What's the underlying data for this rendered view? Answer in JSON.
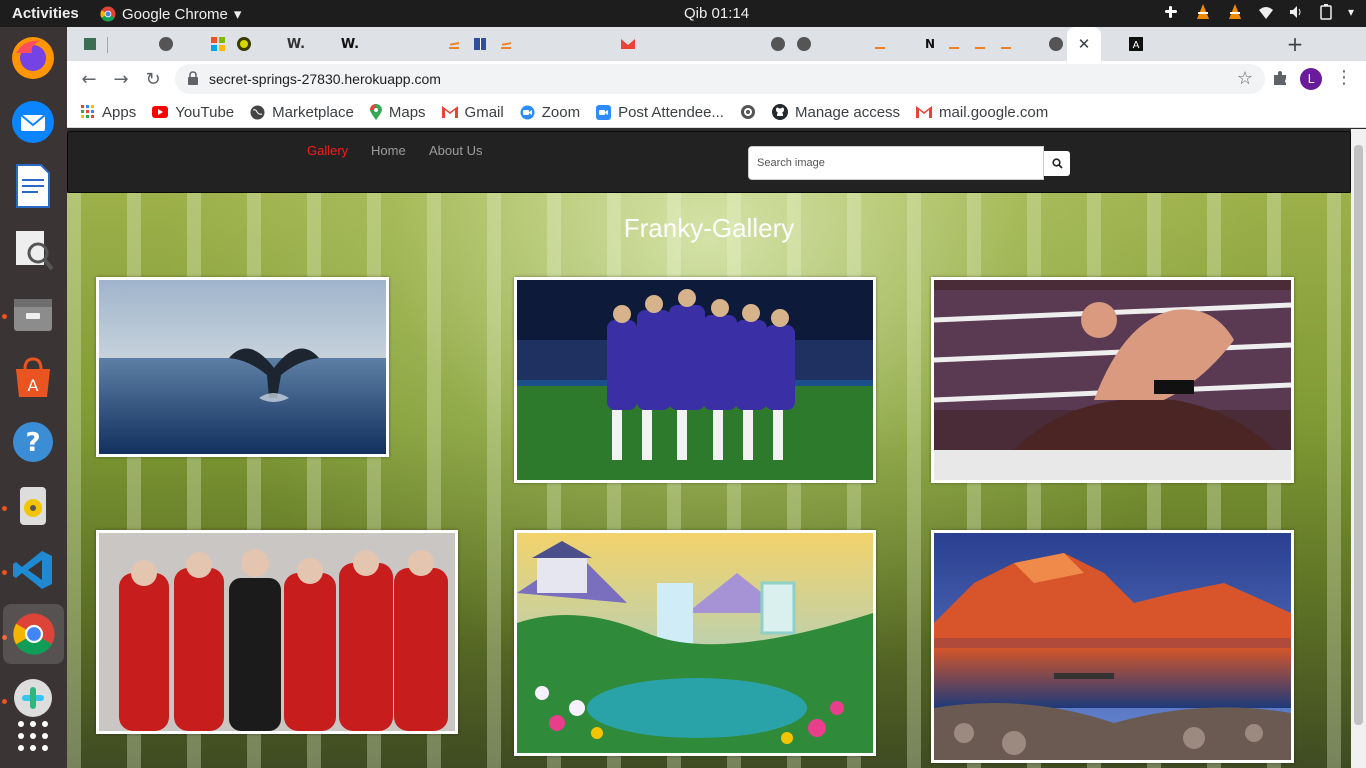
{
  "system": {
    "activities": "Activities",
    "app_name": "Google Chrome",
    "clock": "Qib 01:14"
  },
  "browser": {
    "url": "secret-springs-27830.herokuapp.com",
    "avatar_letter": "L",
    "bookmarks": [
      {
        "label": "Apps",
        "icon": "apps-grid-icon"
      },
      {
        "label": "YouTube",
        "icon": "youtube-icon"
      },
      {
        "label": "Marketplace",
        "icon": "globe-icon"
      },
      {
        "label": "Maps",
        "icon": "maps-pin-icon"
      },
      {
        "label": "Gmail",
        "icon": "gmail-icon"
      },
      {
        "label": "Zoom",
        "icon": "zoom-icon"
      },
      {
        "label": "Post Attendee...",
        "icon": "zoom-video-icon"
      },
      {
        "label": "",
        "icon": "circle-logo-icon"
      },
      {
        "label": "Manage access",
        "icon": "github-icon"
      },
      {
        "label": "mail.google.com",
        "icon": "gmail-icon"
      }
    ]
  },
  "site": {
    "nav": {
      "gallery": "Gallery",
      "home": "Home",
      "about": "About Us"
    },
    "search_placeholder": "Search image",
    "title": "Franky-Gallery",
    "photos": [
      {
        "subject": "whale tail in ocean"
      },
      {
        "subject": "football team celebrating"
      },
      {
        "subject": "wrestlers in ring"
      },
      {
        "subject": "group in red jumpsuits"
      },
      {
        "subject": "fantasy waterfall garden"
      },
      {
        "subject": "mountain lake village"
      }
    ]
  }
}
